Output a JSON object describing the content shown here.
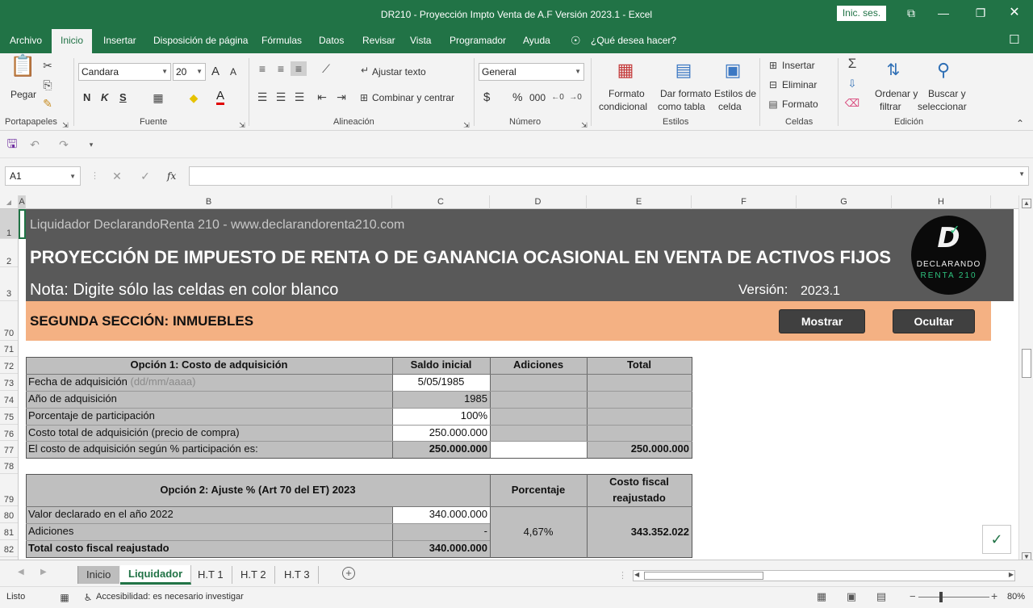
{
  "window": {
    "title": "DR210 - Proyección Impto Venta de A.F Versión 2023.1  -  Excel",
    "signin_label": "Inic. ses."
  },
  "menu": {
    "tabs": [
      "Archivo",
      "Inicio",
      "Insertar",
      "Disposición de página",
      "Fórmulas",
      "Datos",
      "Revisar",
      "Vista",
      "Programador",
      "Ayuda"
    ],
    "search_placeholder": "¿Qué desea hacer?"
  },
  "ribbon": {
    "clipboard": {
      "paste_label": "Pegar",
      "group_label": "Portapapeles"
    },
    "font": {
      "font_name": "Candara",
      "font_size": "20",
      "bold": "N",
      "italic": "K",
      "underline": "S",
      "font_color_letter": "A",
      "group_label": "Fuente",
      "grow_label": "A",
      "shrink_label": "A"
    },
    "alignment": {
      "wrap_label": "Ajustar texto",
      "merge_label": "Combinar y centrar",
      "group_label": "Alineación"
    },
    "number": {
      "format_value": "General",
      "currency": "$",
      "percent": "%",
      "thousands": "000",
      "group_label": "Número"
    },
    "styles": {
      "conditional_label_1": "Formato",
      "conditional_label_2": "condicional",
      "table_label_1": "Dar formato",
      "table_label_2": "como tabla",
      "cell_styles_label_1": "Estilos de",
      "cell_styles_label_2": "celda",
      "group_label": "Estilos"
    },
    "cells": {
      "insert_label": "Insertar",
      "delete_label": "Eliminar",
      "format_label": "Formato",
      "group_label": "Celdas"
    },
    "editing": {
      "sort_label_1": "Ordenar y",
      "sort_label_2": "filtrar",
      "find_label_1": "Buscar y",
      "find_label_2": "seleccionar",
      "group_label": "Edición"
    }
  },
  "formula_bar": {
    "name_box": "A1",
    "fx": "fx",
    "formula_value": ""
  },
  "columns": [
    "A",
    "B",
    "C",
    "D",
    "E",
    "F",
    "G",
    "H"
  ],
  "rows": [
    "1",
    "2",
    "3",
    "70",
    "71",
    "72",
    "73",
    "74",
    "75",
    "76",
    "77",
    "78",
    "79",
    "80",
    "81",
    "82"
  ],
  "header_band": {
    "site_line": "Liquidador DeclarandoRenta 210 - www.declarandorenta210.com",
    "main_title": "PROYECCIÓN DE IMPUESTO DE RENTA O DE GANANCIA OCASIONAL EN VENTA DE ACTIVOS FIJOS",
    "note": "Nota: Digite sólo las celdas en color blanco",
    "version_label": "Versión:",
    "version_value": "2023.1",
    "logo_line1": "DECLARANDO",
    "logo_line2": "RENTA 210",
    "logo_letter": "D"
  },
  "section": {
    "title": "SEGUNDA SECCIÓN: INMUEBLES",
    "show_button": "Mostrar",
    "hide_button": "Ocultar"
  },
  "option1": {
    "headers": [
      "Opción 1: Costo de adquisición",
      "Saldo inicial",
      "Adiciones",
      "Total"
    ],
    "rows": [
      {
        "label": "Fecha de adquisición",
        "hint": "(dd/mm/aaaa)",
        "saldo": "5/05/1985",
        "adiciones": "",
        "total": ""
      },
      {
        "label": "Año de adquisición",
        "hint": "",
        "saldo": "1985",
        "adiciones": "",
        "total": ""
      },
      {
        "label": "Porcentaje de participación",
        "hint": "",
        "saldo": "100%",
        "adiciones": "",
        "total": ""
      },
      {
        "label": "Costo total de adquisición (precio de compra)",
        "hint": "",
        "saldo": "250.000.000",
        "adiciones": "",
        "total": ""
      },
      {
        "label": "El costo de adquisición según % participación es:",
        "hint": "",
        "saldo": "250.000.000",
        "adiciones": "",
        "total": "250.000.000"
      }
    ]
  },
  "option2": {
    "header_main": "Opción 2: Ajuste % (Art 70 del ET) 2023",
    "header_pct": "Porcentaje",
    "header_cost_1": "Costo fiscal",
    "header_cost_2": "reajustado",
    "rows": [
      {
        "label": "Valor declarado en el año 2022",
        "value": "340.000.000"
      },
      {
        "label": "Adiciones",
        "value": "-"
      },
      {
        "label": "Total costo fiscal reajustado",
        "value": "340.000.000"
      }
    ],
    "percentage": "4,67%",
    "adjusted_cost": "343.352.022"
  },
  "sheet_tabs": [
    "Inicio",
    "Liquidador",
    "H.T 1",
    "H.T 2",
    "H.T 3"
  ],
  "status": {
    "ready": "Listo",
    "accessibility": "Accesibilidad: es necesario investigar",
    "zoom": "80%"
  },
  "colors": {
    "excel_green": "#217346",
    "band": "#595959",
    "section": "#f4b183",
    "table_gray": "#bfbfbf"
  }
}
